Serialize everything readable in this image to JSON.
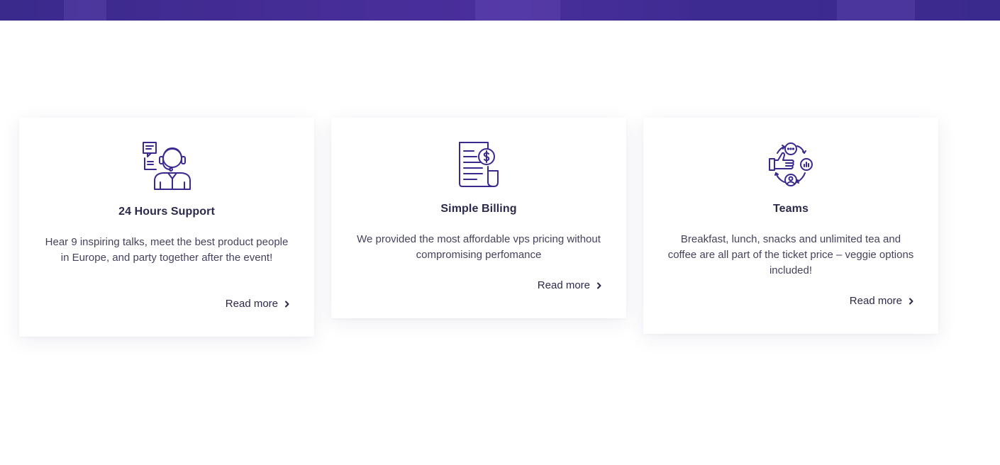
{
  "colors": {
    "accent": "#3b2a8e",
    "title": "#2c2a4a",
    "text": "#45435c"
  },
  "cards": [
    {
      "icon": "customer-support-icon",
      "title": "24 Hours Support",
      "description": "Hear 9 inspiring talks, meet the best product people in Europe, and party together after the event!",
      "link_label": "Read more"
    },
    {
      "icon": "billing-invoice-icon",
      "title": "Simple Billing",
      "description": "We provided the most affordable vps pricing without compromising perfomance",
      "link_label": "Read more"
    },
    {
      "icon": "teams-feedback-icon",
      "title": "Teams",
      "description": "Breakfast, lunch, snacks and unlimited tea and coffee are all part of the ticket price – veggie options included!",
      "link_label": "Read more"
    }
  ]
}
